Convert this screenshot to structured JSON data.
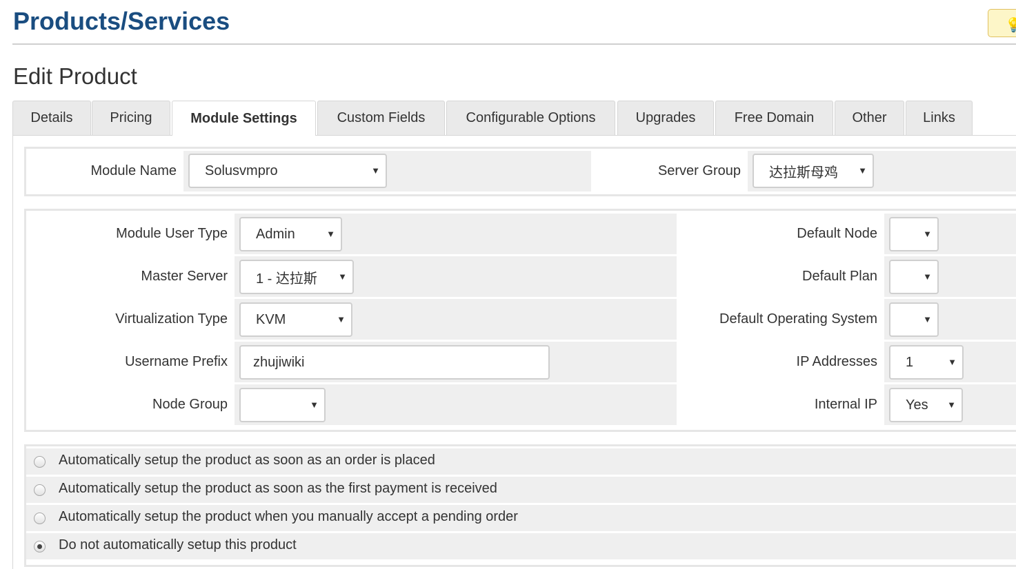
{
  "header": {
    "title": "Products/Services",
    "hint_icon": "lightbulb-icon"
  },
  "sub_title": "Edit Product",
  "tabs": [
    {
      "label": "Details"
    },
    {
      "label": "Pricing"
    },
    {
      "label": "Module Settings",
      "active": true
    },
    {
      "label": "Custom Fields"
    },
    {
      "label": "Configurable Options"
    },
    {
      "label": "Upgrades"
    },
    {
      "label": "Free Domain"
    },
    {
      "label": "Other"
    },
    {
      "label": "Links"
    }
  ],
  "module_box": {
    "module_name_label": "Module Name",
    "module_name_value": "Solusvmpro",
    "server_group_label": "Server Group",
    "server_group_value": "达拉斯母鸡"
  },
  "config_box": {
    "left": [
      {
        "label": "Module User Type",
        "value": "Admin",
        "type": "select"
      },
      {
        "label": "Master Server",
        "value": "1 - 达拉斯",
        "type": "select"
      },
      {
        "label": "Virtualization Type",
        "value": "KVM",
        "type": "select"
      },
      {
        "label": "Username Prefix",
        "value": "zhujiwiki",
        "type": "text"
      },
      {
        "label": "Node Group",
        "value": "",
        "type": "select"
      }
    ],
    "right": [
      {
        "label": "Default Node",
        "value": "",
        "type": "select"
      },
      {
        "label": "Default Plan",
        "value": "",
        "type": "select"
      },
      {
        "label": "Default Operating System",
        "value": "",
        "type": "select"
      },
      {
        "label": "IP Addresses",
        "value": "1",
        "type": "select"
      },
      {
        "label": "Internal IP",
        "value": "Yes",
        "type": "select"
      }
    ]
  },
  "setup_options": [
    {
      "label": "Automatically setup the product as soon as an order is placed",
      "checked": false
    },
    {
      "label": "Automatically setup the product as soon as the first payment is received",
      "checked": false
    },
    {
      "label": "Automatically setup the product when you manually accept a pending order",
      "checked": false
    },
    {
      "label": "Do not automatically setup this product",
      "checked": true
    }
  ],
  "caret_glyph": "▼"
}
